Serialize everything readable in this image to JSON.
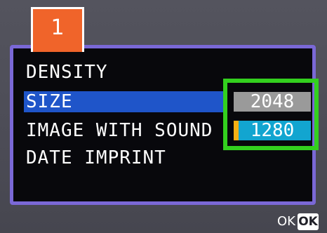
{
  "tab": {
    "label": "1"
  },
  "menu": {
    "items": [
      {
        "label": "DENSITY",
        "selected": false
      },
      {
        "label": "SIZE",
        "selected": true
      },
      {
        "label": "IMAGE WITH SOUND",
        "selected": false
      },
      {
        "label": "DATE IMPRINT",
        "selected": false
      }
    ]
  },
  "size_options": [
    {
      "label": "2048",
      "state": "current"
    },
    {
      "label": "1280",
      "state": "highlighted"
    }
  ],
  "footer": {
    "ok_text": "OK",
    "ok_button": "OK"
  },
  "colors": {
    "tab": "#f0642a",
    "frame_border": "#7a68d6",
    "selection": "#1f55c9",
    "focus_box": "#33d01e",
    "option_current": "#9a9a9a",
    "option_highlight": "#12a5d0",
    "option_marker": "#f6b014"
  }
}
